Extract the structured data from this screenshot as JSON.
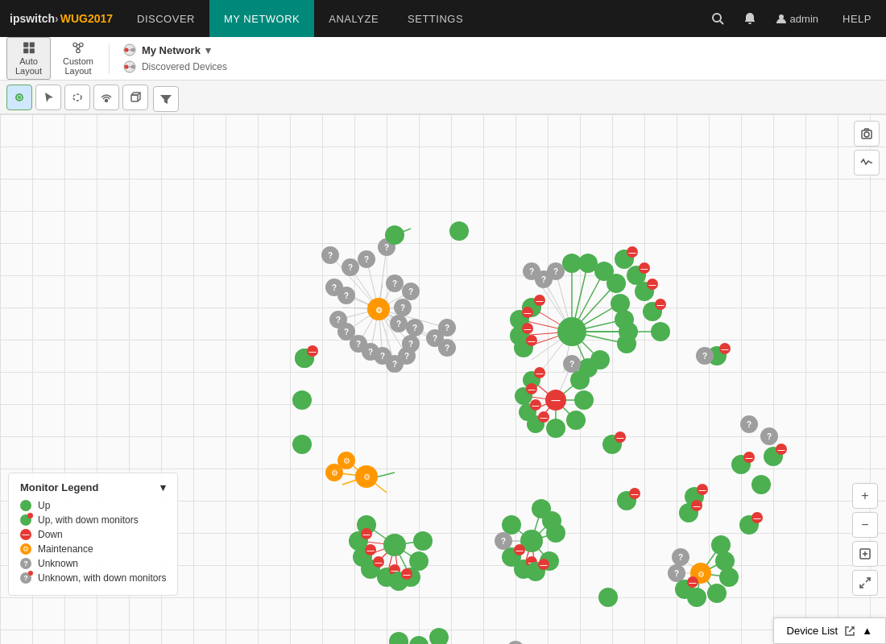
{
  "header": {
    "logo": "ipswitch > WUG2017",
    "logo_ip": "ipswitch",
    "logo_arrow": " >",
    "logo_wug": "WUG2017",
    "nav": [
      "DISCOVER",
      "MY NETWORK",
      "ANALYZE",
      "SETTINGS"
    ],
    "active_nav": "MY NETWORK",
    "icons": [
      "search",
      "bell",
      "user",
      "help"
    ],
    "user_label": "admin",
    "help_label": "HELP"
  },
  "toolbar": {
    "auto_layout_label": "Auto\nLayout",
    "custom_layout_label": "Custom\nLayout",
    "network_label": "My Network",
    "discovered_label": "Discovered Devices"
  },
  "tools": {
    "items": [
      "select",
      "pointer",
      "lasso",
      "wireless",
      "cube"
    ]
  },
  "legend": {
    "title": "Monitor Legend",
    "items": [
      {
        "label": "Up",
        "type": "up"
      },
      {
        "label": "Up, with down monitors",
        "type": "up-down"
      },
      {
        "label": "Down",
        "type": "down"
      },
      {
        "label": "Maintenance",
        "type": "maintenance"
      },
      {
        "label": "Unknown",
        "type": "unknown"
      },
      {
        "label": "Unknown, with down monitors",
        "type": "unknown-down"
      }
    ]
  },
  "device_list": {
    "label": "Device List"
  },
  "zoom": {
    "plus": "+",
    "minus": "−",
    "fit": "⊡",
    "expand": "⤢"
  }
}
